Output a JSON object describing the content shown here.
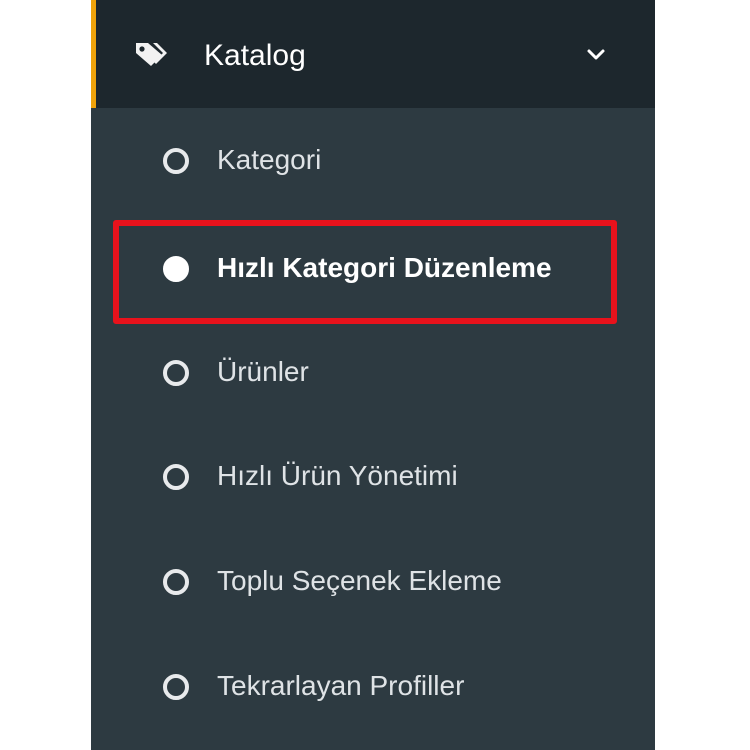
{
  "menu": {
    "header": {
      "title": "Katalog",
      "icon": "tag-icon",
      "expand_icon": "chevron-down-icon",
      "accent_color": "#f0a30a"
    },
    "items": [
      {
        "label": "Kategori",
        "active": false
      },
      {
        "label": "Hızlı Kategori Düzenleme",
        "active": true
      },
      {
        "label": "Ürünler",
        "active": false
      },
      {
        "label": "Hızlı Ürün Yönetimi",
        "active": false
      },
      {
        "label": "Toplu Seçenek Ekleme",
        "active": false
      },
      {
        "label": "Tekrarlayan Profiller",
        "active": false
      }
    ]
  },
  "colors": {
    "sidebar_bg": "#2d3a41",
    "header_bg": "#1d272d",
    "highlight_border": "#e8121c",
    "text": "#dfe3e6"
  }
}
